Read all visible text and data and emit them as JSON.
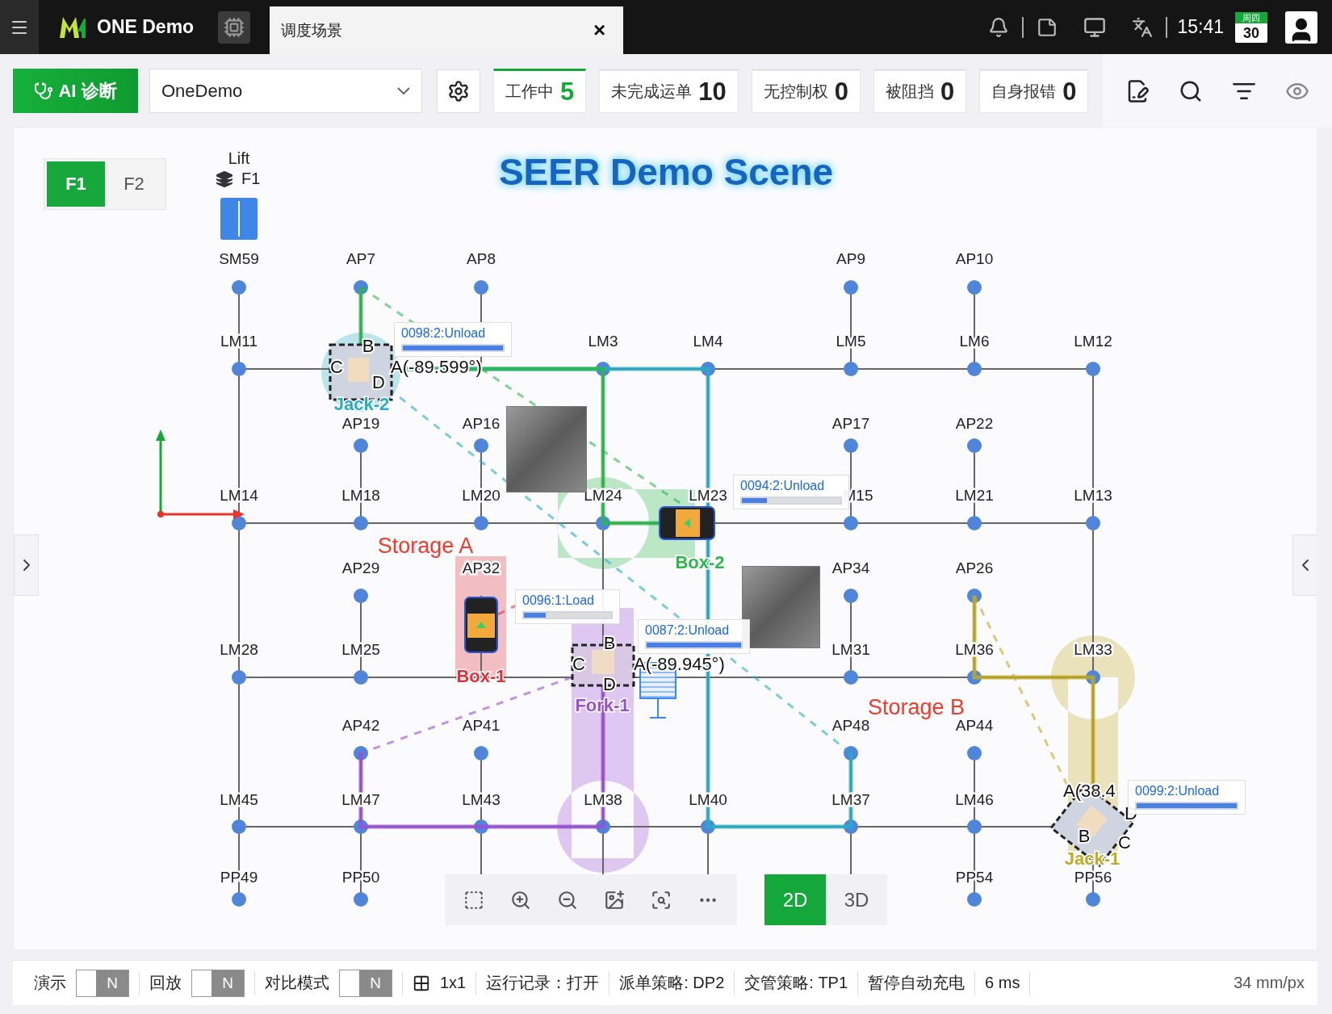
{
  "top_bar": {
    "app_name": "ONE Demo",
    "tab": {
      "label": "调度场景",
      "close": "×"
    },
    "time": "15:41",
    "calendar": {
      "weekday": "周四",
      "day": "30"
    }
  },
  "toolbar": {
    "ai_button": "AI 诊断",
    "scene_select": "OneDemo",
    "stats": [
      {
        "label": "工作中",
        "value": "5",
        "selected": true
      },
      {
        "label": "未完成运单",
        "value": "10",
        "selected": false
      },
      {
        "label": "无控制权",
        "value": "0",
        "selected": false
      },
      {
        "label": "被阻挡",
        "value": "0",
        "selected": false
      },
      {
        "label": "自身报错",
        "value": "0",
        "selected": false
      }
    ]
  },
  "map": {
    "floors": [
      {
        "label": "F1",
        "selected": true
      },
      {
        "label": "F2",
        "selected": false
      }
    ],
    "lift": {
      "label": "Lift",
      "floor": "F1"
    },
    "title": "SEER Demo Scene",
    "areas": [
      "Storage A",
      "Storage B"
    ],
    "node_labels": [
      "SM59",
      "AP7",
      "AP8",
      "AP9",
      "AP10",
      "LM11",
      "LM3",
      "LM4",
      "LM5",
      "LM6",
      "LM12",
      "AP19",
      "AP16",
      "AP17",
      "AP22",
      "LM14",
      "LM18",
      "LM20",
      "LM24",
      "LM23",
      "M15",
      "LM21",
      "LM13",
      "AP29",
      "AP32",
      "AP34",
      "AP26",
      "LM28",
      "LM25",
      "LM31",
      "LM36",
      "LM33",
      "AP42",
      "AP41",
      "AP48",
      "AP44",
      "LM45",
      "LM47",
      "LM43",
      "LM38",
      "LM40",
      "LM37",
      "LM46",
      "PP49",
      "PP50",
      "PP54",
      "PP56"
    ],
    "robots": [
      {
        "name": "Jack-2",
        "kind": "jack",
        "color": "#27aec4",
        "angle": "A(-89.599°)",
        "corners": [
          "B",
          "C",
          "D"
        ],
        "task": {
          "label": "0098:2:Unload",
          "level": 1
        }
      },
      {
        "name": "Box-2",
        "kind": "box",
        "color": "#2cb84c",
        "task": {
          "label": "0094:2:Unload",
          "level": 0.25
        }
      },
      {
        "name": "Box-1",
        "kind": "box",
        "color": "#e0323a",
        "task": {
          "label": "0096:1:Load",
          "level": 0.25
        }
      },
      {
        "name": "Fork-1",
        "kind": "fork",
        "color": "#9a4ed4",
        "angle": "A(-89.945°)",
        "corners": [
          "B",
          "C",
          "D"
        ],
        "task": {
          "label": "0087:2:Unload",
          "level": 1
        }
      },
      {
        "name": "Jack-1",
        "kind": "jack",
        "color": "#c2aa22",
        "angle": "A(38.4",
        "corners": [
          "B",
          "C",
          "D"
        ],
        "task": {
          "label": "0099:2:Unload",
          "level": 1
        }
      }
    ],
    "view_modes": [
      {
        "label": "2D",
        "selected": true
      },
      {
        "label": "3D",
        "selected": false
      }
    ]
  },
  "status_bar": {
    "items": [
      {
        "kind": "toggle",
        "label": "演示",
        "value": "N",
        "on": false
      },
      {
        "kind": "toggle",
        "label": "回放",
        "value": "N",
        "on": false
      },
      {
        "kind": "toggle",
        "label": "对比模式",
        "value": "N",
        "on": false
      },
      {
        "kind": "grid",
        "label": "1x1"
      },
      {
        "kind": "text",
        "label": "运行记录：打开"
      },
      {
        "kind": "text",
        "label": "派单策略: DP2"
      },
      {
        "kind": "text",
        "label": "交管策略: TP1"
      },
      {
        "kind": "text",
        "label": "暂停自动充电"
      },
      {
        "kind": "text",
        "label": "6 ms"
      }
    ],
    "scale": "34 mm/px"
  }
}
